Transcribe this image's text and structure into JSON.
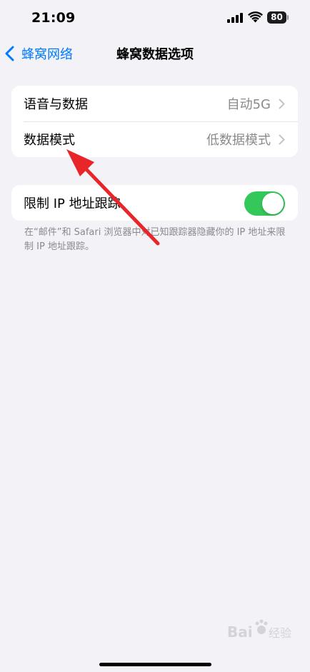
{
  "status_bar": {
    "time": "21:09",
    "battery": "80",
    "icons": [
      "signal-icon",
      "wifi-icon",
      "battery-icon"
    ]
  },
  "nav": {
    "back_label": "蜂窝网络",
    "title": "蜂窝数据选项"
  },
  "groups": [
    {
      "rows": [
        {
          "label": "语音与数据",
          "value": "自动5G"
        },
        {
          "label": "数据模式",
          "value": "低数据模式"
        }
      ]
    },
    {
      "rows": [
        {
          "label": "限制 IP 地址跟踪",
          "toggle_on": true
        }
      ],
      "footnote": "在“邮件”和 Safari 浏览器中对已知跟踪器隐藏你的 IP 地址来限制 IP 地址跟踪。"
    }
  ],
  "annotation": {
    "type": "red-arrow",
    "color": "#e8262a",
    "points_to": "数据模式"
  },
  "colors": {
    "accent": "#007aff",
    "toggle_on": "#34c759",
    "background": "#f2f2f7",
    "secondary_text": "#8a8a8e"
  }
}
